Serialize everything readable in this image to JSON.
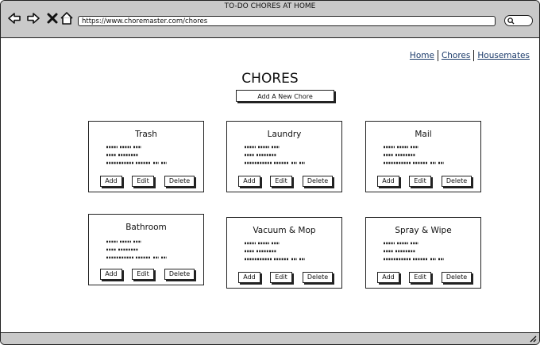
{
  "window": {
    "title": "TO-DO CHORES AT HOME"
  },
  "browser": {
    "url": "https://www.choremaster.com/chores"
  },
  "nav": {
    "home": "Home",
    "chores": "Chores",
    "housemates": "Housemates"
  },
  "page": {
    "title": "CHORES",
    "add_button": "Add A New Chore"
  },
  "cards": [
    {
      "title": "Trash",
      "add": "Add",
      "edit": "Edit",
      "delete": "Delete"
    },
    {
      "title": "Laundry",
      "add": "Add",
      "edit": "Edit",
      "delete": "Delete"
    },
    {
      "title": "Mail",
      "add": "Add",
      "edit": "Edit",
      "delete": "Delete"
    },
    {
      "title": "Bathroom",
      "add": "Add",
      "edit": "Edit",
      "delete": "Delete"
    },
    {
      "title": "Vacuum & Mop",
      "add": "Add",
      "edit": "Edit",
      "delete": "Delete"
    },
    {
      "title": "Spray & Wipe",
      "add": "Add",
      "edit": "Edit",
      "delete": "Delete"
    }
  ],
  "icons": {
    "back": "arrow-left-icon",
    "forward": "arrow-right-icon",
    "stop": "close-icon",
    "home": "home-icon",
    "search": "search-icon",
    "resize": "resize-grip-icon"
  }
}
